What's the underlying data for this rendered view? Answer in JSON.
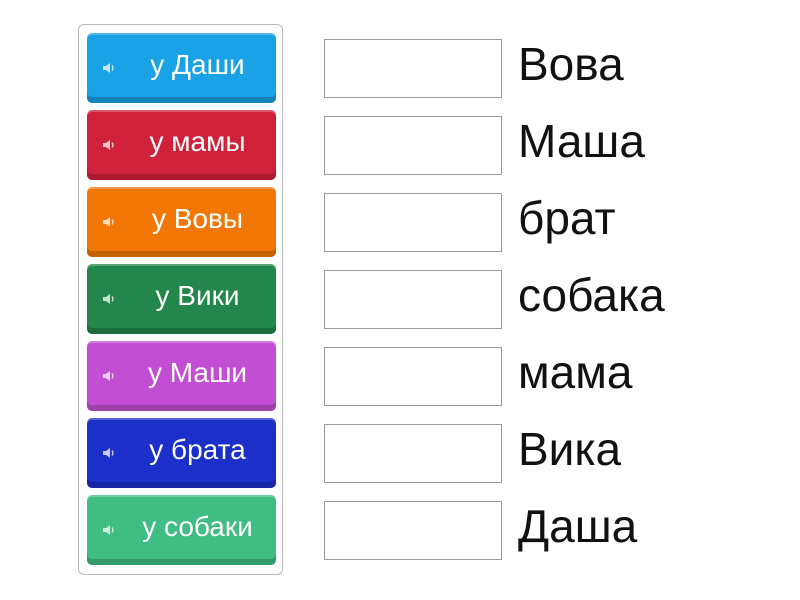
{
  "tiles": [
    {
      "label": "у Даши",
      "color": "#1aa2e6",
      "icon": "speaker-icon"
    },
    {
      "label": "у мамы",
      "color": "#d0213a",
      "icon": "speaker-icon"
    },
    {
      "label": "у Вовы",
      "color": "#f27707",
      "icon": "speaker-icon"
    },
    {
      "label": "у Вики",
      "color": "#23864a",
      "icon": "speaker-icon"
    },
    {
      "label": "у Маши",
      "color": "#c24fd3",
      "icon": "speaker-icon"
    },
    {
      "label": "у брата",
      "color": "#1d2fc9",
      "icon": "speaker-icon"
    },
    {
      "label": "у собаки",
      "color": "#3fbd82",
      "icon": "speaker-icon"
    }
  ],
  "targets": [
    {
      "word": "Вова"
    },
    {
      "word": "Маша"
    },
    {
      "word": "брат"
    },
    {
      "word": "собака"
    },
    {
      "word": "мама"
    },
    {
      "word": "Вика"
    },
    {
      "word": "Даша"
    }
  ]
}
